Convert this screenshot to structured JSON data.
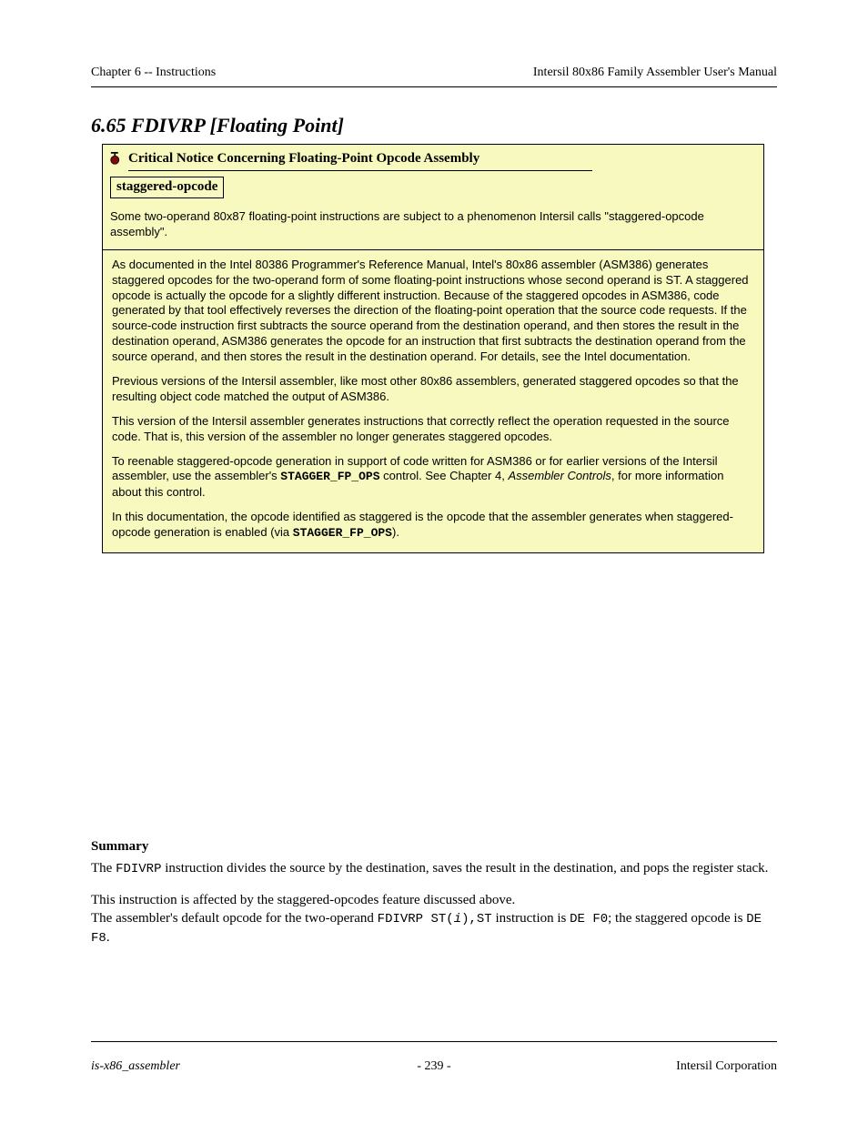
{
  "header": {
    "left": "Chapter 6 -- Instructions",
    "right": "Intersil 80x86 Family Assembler User's Manual"
  },
  "section_title": "6.65 FDIVRP [Floating Point]",
  "notice": {
    "title": "Critical Notice Concerning Floating-Point Opcode Assembly",
    "defined_term": "staggered-opcode",
    "intro": "Some two-operand 80x87 floating-point instructions are subject to a phenomenon Intersil calls \"staggered-opcode assembly\".",
    "paragraphs": [
      "As documented in the Intel 80386 Programmer's Reference Manual, Intel's 80x86 assembler (ASM386) generates staggered opcodes for the two-operand form of some floating-point instructions whose second operand is ST. A staggered opcode is actually the opcode for a slightly different instruction. Because of the staggered opcodes in ASM386, code generated by that tool effectively reverses the direction of the floating-point operation that the source code requests. If the source-code instruction first subtracts the source operand from the destination operand, and then stores the result in the destination operand, ASM386 generates the opcode for an instruction that first subtracts the destination operand from the source operand, and then stores the result in the destination operand. For details, see the Intel documentation.",
      "Previous versions of the Intersil assembler, like most other 80x86 assemblers, generated staggered opcodes so that the resulting object code matched the output of ASM386.",
      "This version of the Intersil assembler generates instructions that correctly reflect the operation requested in the source code. That is, this version of the assembler no longer generates staggered opcodes.",
      "To reenable staggered-opcode generation in support of code written for ASM386 or for earlier versions of the Intersil assembler, use the assembler's <span class=\"midfix\">STAGGER_FP_OPS</span> control. See Chapter 4, <span class=\"ital\">Assembler Controls</span>, for more information about this control.",
      "In this documentation, the opcode identified as staggered is the opcode that the assembler generates when staggered-opcode generation is enabled (via <span class=\"midfix\">STAGGER_FP_OPS</span>)."
    ]
  },
  "body": {
    "heading": "Summary",
    "p1_pre": "The ",
    "p1_mono": "FDIVRP",
    "p1_post": " instruction divides the source by the destination, saves the result in the destination, and pops the register stack.",
    "p2_line1": "This instruction is affected by the staggered-opcodes feature discussed above.",
    "p2_line2_pre": "The assembler's default opcode for the two-operand ",
    "p2_line2_mono1": "FDIVRP ST(",
    "p2_line2_ital": "i",
    "p2_line2_mono2": "),ST",
    "p2_line2_mid": " instruction is ",
    "p2_line2_mono3": "DE F0",
    "p2_line2_end": "; the staggered opcode is ",
    "p2_line2_mono4": "DE F8",
    "p2_line2_tail": "."
  },
  "footer": {
    "left": "is-x86_assembler",
    "center": "- 239 -",
    "right": "Intersil Corporation"
  }
}
